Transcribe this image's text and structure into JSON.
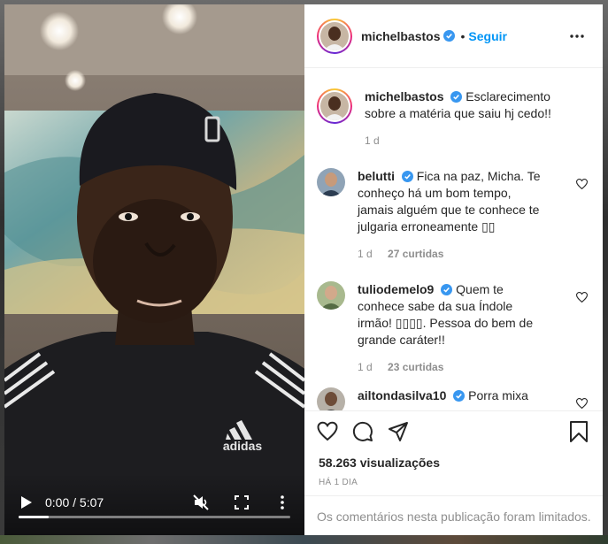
{
  "post": {
    "author": "michelbastos",
    "follow_label": "Seguir",
    "dot": "•",
    "caption": "Esclarecimento sobre a matéria que saiu hj cedo!!",
    "caption_time": "1 d"
  },
  "video": {
    "time": "0:00 / 5:07",
    "progress": 0.11,
    "shirt_brand": "adidas"
  },
  "comments": [
    {
      "user": "belutti",
      "text": "Fica na paz, Micha. Te conheço há um bom tempo, jamais alguém que te conhece te julgaria erroneamente ▯▯",
      "time": "1 d",
      "likes": "27 curtidas"
    },
    {
      "user": "tuliodemelo9",
      "text": "Quem te conhece sabe da sua Índole irmão! ▯▯▯▯. Pessoa do bem de grande caráter!!",
      "time": "1 d",
      "likes": "23 curtidas"
    },
    {
      "user": "ailtondasilva10",
      "text": "Porra mixa"
    }
  ],
  "footer": {
    "views": "58.263 visualizações",
    "posted": "HÁ 1 DIA",
    "limited": "Os comentários nesta publicação foram limitados."
  },
  "colors": {
    "accent": "#0095f6",
    "verified": "#3897f0",
    "muted": "#8e8e8e"
  }
}
